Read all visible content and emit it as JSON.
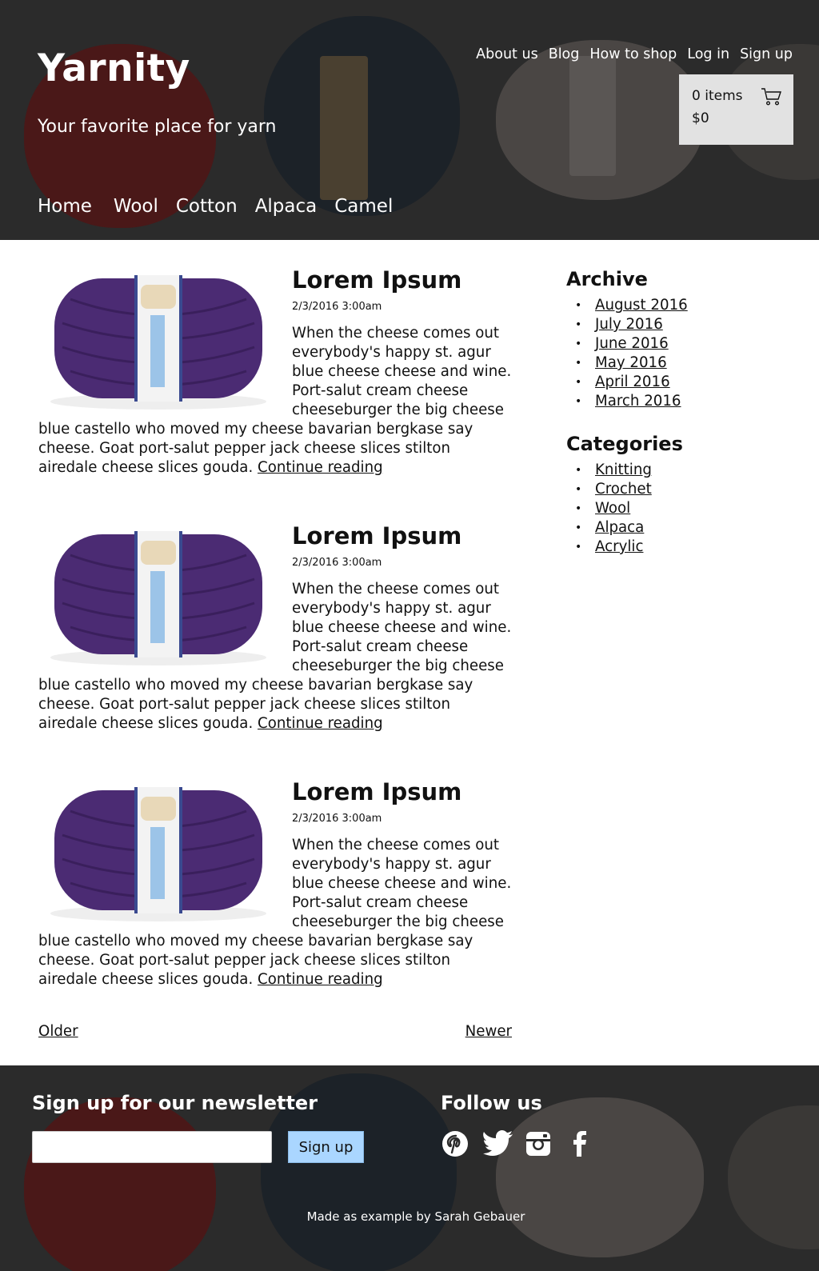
{
  "header": {
    "site_title": "Yarnity",
    "tagline": "Your favorite place for yarn",
    "top_nav": [
      "About us",
      "Blog",
      "How to shop",
      "Log in",
      "Sign up"
    ],
    "cart": {
      "items": "0 items",
      "total": "$0"
    },
    "main_nav": [
      "Home",
      "Wool",
      "Cotton",
      "Alpaca",
      "Camel"
    ]
  },
  "posts": [
    {
      "title": "Lorem Ipsum",
      "date": "2/3/2016 3:00am",
      "body": "When the cheese comes out everybody's happy st. agur blue cheese cheese and wine. Port-salut cream cheese cheeseburger the big cheese blue castello who moved my cheese bavarian bergkase say cheese. Goat port-salut pepper jack cheese slices stilton airedale cheese slices gouda.",
      "link": "Continue reading"
    },
    {
      "title": "Lorem Ipsum",
      "date": "2/3/2016 3:00am",
      "body": "When the cheese comes out everybody's happy st. agur blue cheese cheese and wine. Port-salut cream cheese cheeseburger the big cheese blue castello who moved my cheese bavarian bergkase say cheese. Goat port-salut pepper jack cheese slices stilton airedale cheese slices gouda.",
      "link": "Continue reading"
    },
    {
      "title": "Lorem Ipsum",
      "date": "2/3/2016 3:00am",
      "body": "When the cheese comes out everybody's happy st. agur blue cheese cheese and wine. Port-salut cream cheese cheeseburger the big cheese blue castello who moved my cheese bavarian bergkase say cheese. Goat port-salut pepper jack cheese slices stilton airedale cheese slices gouda.",
      "link": "Continue reading"
    }
  ],
  "pager": {
    "older": "Older",
    "newer": "Newer"
  },
  "sidebar": {
    "archive_heading": "Archive",
    "archive": [
      "August 2016",
      "July 2016",
      "June 2016",
      "May 2016",
      "April 2016",
      "March 2016"
    ],
    "categories_heading": "Categories",
    "categories": [
      "Knitting",
      "Crochet",
      "Wool",
      "Alpaca",
      "Acrylic"
    ]
  },
  "footer": {
    "newsletter_heading": "Sign up for our newsletter",
    "newsletter_button": "Sign up",
    "follow_heading": "Follow us",
    "social_icons": [
      "pinterest-icon",
      "twitter-icon",
      "instagram-icon",
      "facebook-icon"
    ],
    "credit": "Made as example by Sarah Gebauer"
  },
  "colors": {
    "header_bg": "#2b2b2b",
    "cart_bg": "#e2e2e2",
    "button_bg": "#aad6ff",
    "yarn_purple": "#4b2b73"
  }
}
